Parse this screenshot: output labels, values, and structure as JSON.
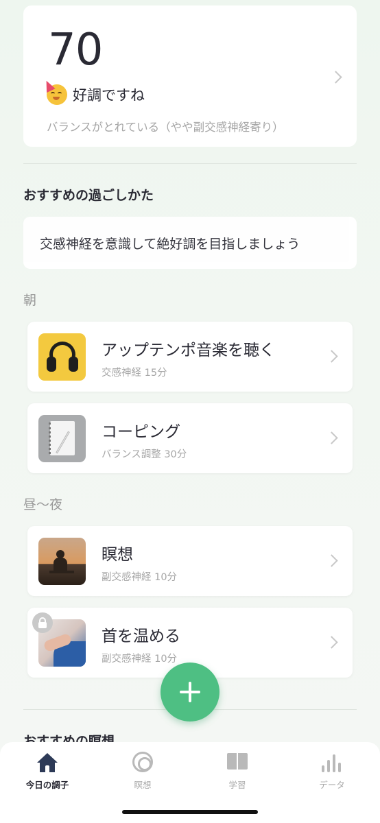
{
  "summary": {
    "score": "70",
    "status_label": "好調ですね",
    "status_detail": "バランスがとれている（やや副交感神経寄り）"
  },
  "recommend": {
    "section_title": "おすすめの過ごしかた",
    "advice": "交感神経を意識して絶好調を目指しましょう",
    "groups": [
      {
        "label": "朝",
        "items": [
          {
            "title": "アップテンポ音楽を聴く",
            "meta": "交感神経  15分"
          },
          {
            "title": "コーピング",
            "meta": "バランス調整  30分"
          }
        ]
      },
      {
        "label": "昼〜夜",
        "items": [
          {
            "title": "瞑想",
            "meta": "副交感神経  10分"
          },
          {
            "title": "首を温める",
            "meta": "副交感神経  10分"
          }
        ]
      }
    ]
  },
  "meditation_section_title": "おすすめの瞑想",
  "tabbar": {
    "tabs": [
      {
        "label": "今日の調子",
        "icon": "home-icon",
        "active": true
      },
      {
        "label": "瞑想",
        "icon": "meditation-ring-icon",
        "active": false
      },
      {
        "label": "学習",
        "icon": "book-icon",
        "active": false
      },
      {
        "label": "データ",
        "icon": "bar-chart-icon",
        "active": false
      }
    ]
  },
  "colors": {
    "accent_green": "#4ebf83",
    "text_dark": "#2a2a34",
    "text_muted": "#a6a6a6",
    "tab_active": "#2d3a57"
  }
}
